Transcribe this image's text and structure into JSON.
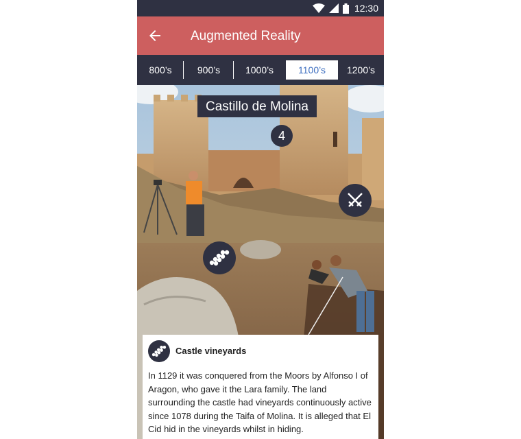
{
  "status_bar": {
    "time": "12:30"
  },
  "app_bar": {
    "title": "Augmented Reality"
  },
  "era_tabs": [
    {
      "label": "800’s",
      "active": false
    },
    {
      "label": "900’s",
      "active": false
    },
    {
      "label": "1000’s",
      "active": false
    },
    {
      "label": "1100’s",
      "active": true
    },
    {
      "label": "1200’s",
      "active": false
    }
  ],
  "scene": {
    "location_label": "Castillo de Molina",
    "marker_count": "4",
    "poi_icons": [
      "swords-icon",
      "grapes-icon"
    ]
  },
  "info_card": {
    "icon": "grapes-icon",
    "title": "Castle vineyards",
    "body": "In 1129 it was conquered from the Moors by Alfonso I of Aragon, who gave it the Lara family. The land surrounding the castle had vineyards continuously active since 1078 during the Taifa of Molina. It is alleged that El Cid hid in the vineyards whilst in hiding."
  },
  "colors": {
    "app_bar": "#cd5f5f",
    "dark": "#2f3142",
    "active_tab_text": "#3b6dbf"
  }
}
